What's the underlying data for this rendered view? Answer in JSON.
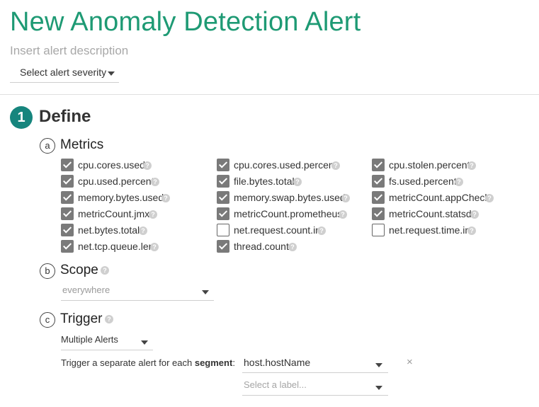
{
  "title": "New Anomaly Detection Alert",
  "description": {
    "placeholder": "Insert alert description",
    "value": ""
  },
  "severity": {
    "label": "Select alert severity"
  },
  "step": {
    "number": "1",
    "label": "Define"
  },
  "metrics": {
    "letter": "a",
    "title": "Metrics",
    "items": [
      {
        "label": "cpu.cores.used",
        "checked": true
      },
      {
        "label": "cpu.cores.used.percent",
        "checked": true
      },
      {
        "label": "cpu.stolen.percent",
        "checked": true
      },
      {
        "label": "cpu.used.percent",
        "checked": true
      },
      {
        "label": "file.bytes.total",
        "checked": true
      },
      {
        "label": "fs.used.percent",
        "checked": true
      },
      {
        "label": "memory.bytes.used",
        "checked": true
      },
      {
        "label": "memory.swap.bytes.used",
        "checked": true
      },
      {
        "label": "metricCount.appCheck",
        "checked": true
      },
      {
        "label": "metricCount.jmx",
        "checked": true
      },
      {
        "label": "metricCount.prometheus",
        "checked": true
      },
      {
        "label": "metricCount.statsd",
        "checked": true
      },
      {
        "label": "net.bytes.total",
        "checked": true
      },
      {
        "label": "net.request.count.in",
        "checked": false
      },
      {
        "label": "net.request.time.in",
        "checked": false
      },
      {
        "label": "net.tcp.queue.len",
        "checked": true
      },
      {
        "label": "thread.count",
        "checked": true
      }
    ]
  },
  "scope": {
    "letter": "b",
    "title": "Scope",
    "value": "everywhere"
  },
  "trigger": {
    "letter": "c",
    "title": "Trigger",
    "mode": "Multiple Alerts",
    "segment_prefix": "Trigger a separate alert for each ",
    "segment_word": "segment",
    "segment_suffix": ":",
    "segment_value": "host.hostName",
    "label_placeholder": "Select a label...",
    "remove_glyph": "×"
  },
  "help_glyph": "?",
  "colors": {
    "accent": "#1e9a74",
    "step": "#16857d",
    "checkbox": "#7a7a7a"
  }
}
